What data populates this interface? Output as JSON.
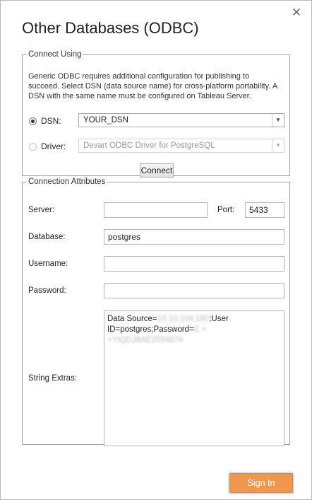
{
  "dialog": {
    "title": "Other Databases (ODBC)",
    "close_glyph": "✕"
  },
  "connect_using": {
    "legend": "Connect Using",
    "description": "Generic ODBC requires additional configuration for publishing to succeed. Select DSN (data source name) for cross-platform portability. A DSN with the same name must be configured on Tableau Server.",
    "dsn_label": "DSN:",
    "dsn_value": "YOUR_DSN",
    "dsn_selected": true,
    "driver_label": "Driver:",
    "driver_value": "Devart ODBC Driver for PostgreSQL",
    "connect_button": "Connect",
    "dropdown_arrow": "▼"
  },
  "connection_attributes": {
    "legend": "Connection Attributes",
    "server_label": "Server:",
    "server_value": "",
    "port_label": "Port:",
    "port_value": "5433",
    "database_label": "Database:",
    "database_value": "postgres",
    "username_label": "Username:",
    "username_value": "",
    "password_label": "Password:",
    "password_value": "",
    "string_extras_label": "String Extras:",
    "string_extras": {
      "part1": "Data Source=",
      "redacted1": "10.10.104.180",
      "part2": ";User ID=postgres;Password=",
      "redacted2": "E + +YtQDJ8AE2034874"
    }
  },
  "footer": {
    "sign_in_button": "Sign In"
  },
  "colors": {
    "accent": "#f0974f",
    "border": "#a0a0a0"
  }
}
